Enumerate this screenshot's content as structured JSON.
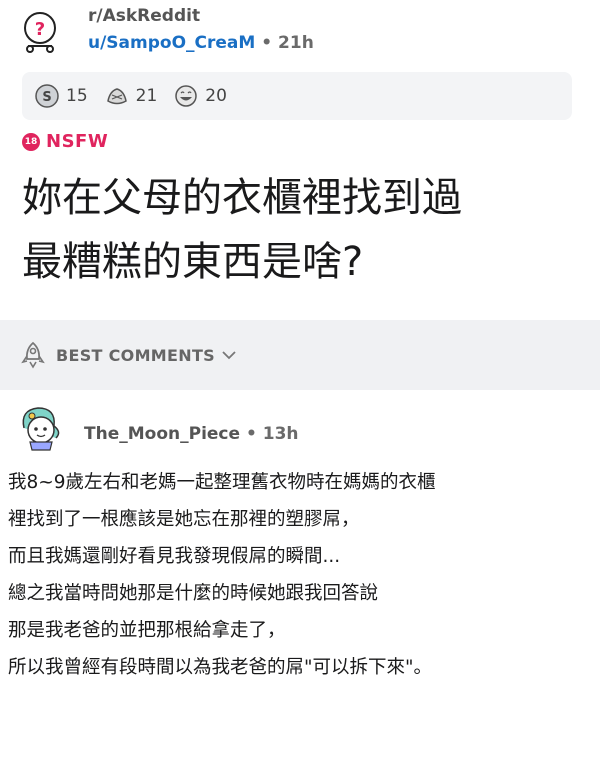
{
  "post": {
    "subreddit": "r/AskReddit",
    "user": "u/SampoO_CreaM",
    "separator": "•",
    "age": "21h",
    "awards": [
      {
        "icon": "silver-coin-icon",
        "count": "15"
      },
      {
        "icon": "helpful-hands-icon",
        "count": "21"
      },
      {
        "icon": "laughing-face-icon",
        "count": "20"
      }
    ],
    "nsfw_badge": "18",
    "nsfw_label": "NSFW",
    "title_lines": [
      "妳在父母的衣櫃裡找到過",
      "最糟糕的東西是啥?"
    ]
  },
  "sort": {
    "label": "BEST COMMENTS",
    "icon": "rocket-icon",
    "chevron": "chevron-down-icon"
  },
  "comment": {
    "author": "The_Moon_Piece",
    "separator": "•",
    "age": "13h",
    "lines": [
      "我8~9歲左右和老媽一起整理舊衣物時在媽媽的衣櫃",
      "裡找到了一根應該是她忘在那裡的塑膠屌，",
      "而且我媽還剛好看見我發現假屌的瞬間...",
      "總之我當時問她那是什麼的時候她跟我回答說",
      "那是我老爸的並把那根給拿走了，",
      "所以我曾經有段時間以為我老爸的屌\"可以拆下來\"。"
    ]
  },
  "colors": {
    "accent_link": "#1a6fc4",
    "nsfw": "#e0245e",
    "bar_bg": "#f0f1f3",
    "award_bg": "#f3f4f6"
  }
}
